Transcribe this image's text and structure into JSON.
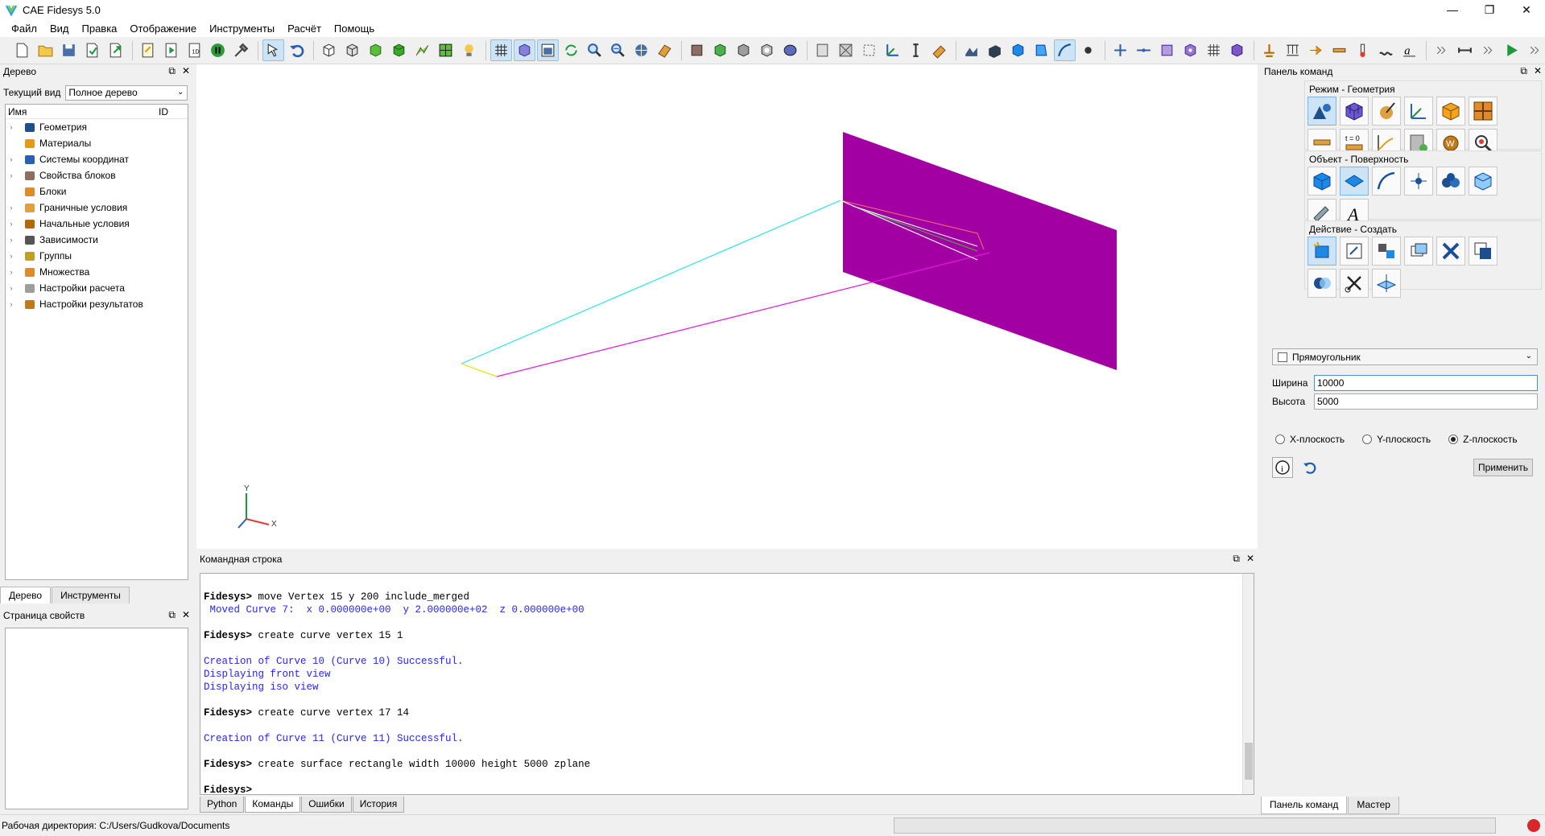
{
  "titlebar": {
    "title": "CAE Fidesys 5.0",
    "minimize": "—",
    "maximize": "❐",
    "close": "✕"
  },
  "menu": [
    "Файл",
    "Вид",
    "Правка",
    "Отображение",
    "Инструменты",
    "Расчёт",
    "Помощь"
  ],
  "tree_panel": {
    "title": "Дерево",
    "current_view_label": "Текущий вид",
    "current_view_value": "Полное дерево",
    "col_name": "Имя",
    "col_id": "ID",
    "items": [
      {
        "label": "Геометрия",
        "icon": "geometry-icon",
        "expandable": true
      },
      {
        "label": "Материалы",
        "icon": "materials-icon",
        "expandable": false
      },
      {
        "label": "Системы координат",
        "icon": "coord-systems-icon",
        "expandable": true
      },
      {
        "label": "Свойства блоков",
        "icon": "block-props-icon",
        "expandable": true
      },
      {
        "label": "Блоки",
        "icon": "blocks-icon",
        "expandable": false
      },
      {
        "label": "Граничные условия",
        "icon": "boundary-conditions-icon",
        "expandable": true
      },
      {
        "label": "Начальные условия",
        "icon": "initial-conditions-icon",
        "expandable": true
      },
      {
        "label": "Зависимости",
        "icon": "dependencies-icon",
        "expandable": true
      },
      {
        "label": "Группы",
        "icon": "groups-icon",
        "expandable": true
      },
      {
        "label": "Множества",
        "icon": "sets-icon",
        "expandable": true
      },
      {
        "label": "Настройки расчета",
        "icon": "calc-settings-icon",
        "expandable": true
      },
      {
        "label": "Настройки результатов",
        "icon": "result-settings-icon",
        "expandable": true
      }
    ]
  },
  "left_tabs": [
    "Дерево",
    "Инструменты"
  ],
  "props_panel": {
    "title": "Страница свойств"
  },
  "viewport": {
    "axis_x": "X",
    "axis_y": "Y"
  },
  "cmd_panel": {
    "title": "Командная строка",
    "lines": [
      {
        "type": "blank",
        "text": ""
      },
      {
        "type": "prompt",
        "prefix": "Fidesys>",
        "text": " move Vertex 15 y 200 include_merged"
      },
      {
        "type": "out",
        "text": " Moved Curve 7:  x 0.000000e+00  y 2.000000e+02  z 0.000000e+00"
      },
      {
        "type": "blank",
        "text": ""
      },
      {
        "type": "prompt",
        "prefix": "Fidesys>",
        "text": " create curve vertex 15 1"
      },
      {
        "type": "blank",
        "text": ""
      },
      {
        "type": "out",
        "text": "Creation of Curve 10 (Curve 10) Successful."
      },
      {
        "type": "out",
        "text": "Displaying front view"
      },
      {
        "type": "out",
        "text": "Displaying iso view"
      },
      {
        "type": "blank",
        "text": ""
      },
      {
        "type": "prompt",
        "prefix": "Fidesys>",
        "text": " create curve vertex 17 14"
      },
      {
        "type": "blank",
        "text": ""
      },
      {
        "type": "out",
        "text": "Creation of Curve 11 (Curve 11) Successful."
      },
      {
        "type": "blank",
        "text": ""
      },
      {
        "type": "prompt",
        "prefix": "Fidesys>",
        "text": " create surface rectangle width 10000 height 5000 zplane"
      },
      {
        "type": "blank",
        "text": ""
      },
      {
        "type": "prompt",
        "prefix": "Fidesys>",
        "text": ""
      }
    ],
    "tabs": [
      "Python",
      "Команды",
      "Ошибки",
      "История"
    ],
    "active_tab": "Команды"
  },
  "command_panel": {
    "title": "Панель команд",
    "mode_title": "Режим - Геометрия",
    "object_title": "Объект - Поверхность",
    "action_title": "Действие - Создать",
    "shape_value": "Прямоугольник",
    "width_label": "Ширина",
    "width_value": "10000",
    "height_label": "Высота",
    "height_value": "5000",
    "plane_options": [
      "X-плоскость",
      "Y-плоскость",
      "Z-плоскость"
    ],
    "plane_selected": "Z-плоскость",
    "apply_label": "Применить",
    "info_label": "i"
  },
  "right_tabs": [
    "Панель команд",
    "Мастер"
  ],
  "status": {
    "workdir": "Рабочая директория: C:/Users/Gudkova/Documents"
  },
  "colors": {
    "surface": "#a300a3",
    "cyan": "#27e6ea",
    "magenta": "#e316e3",
    "yellow": "#e6e61a",
    "accent": "#cde4f7"
  }
}
